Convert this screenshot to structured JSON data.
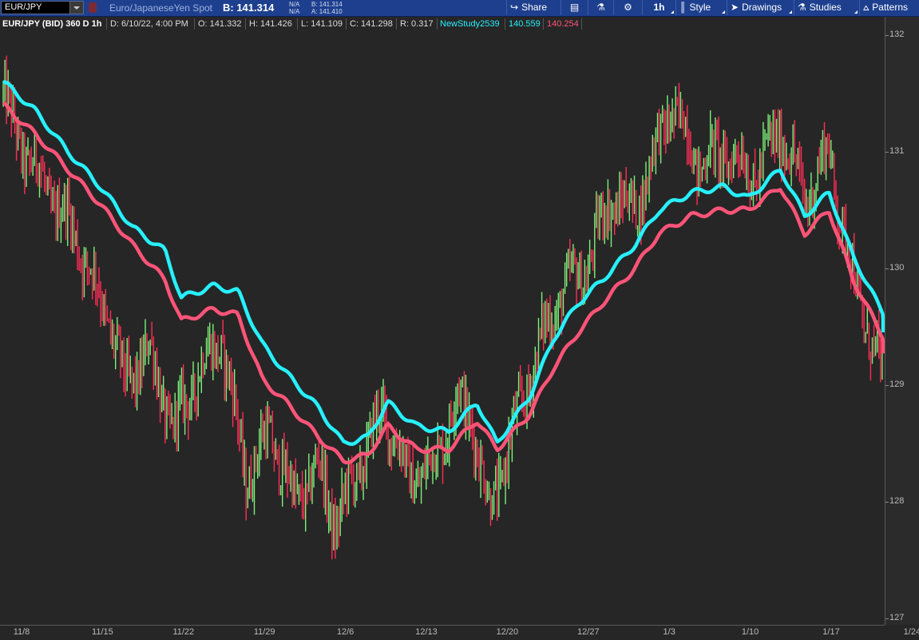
{
  "toolbar": {
    "symbol": "EUR/JPY",
    "description": "Euro/JapaneseYen Spot",
    "bid_price": "B: 141.314",
    "mini_left": [
      "N/A",
      "N/A"
    ],
    "mini_right": [
      "B: 141.314",
      "A: 141.410"
    ],
    "share": "Share",
    "timeframe": "1h",
    "style": "Style",
    "drawings": "Drawings",
    "studies": "Studies",
    "patterns": "Patterns"
  },
  "infobar": {
    "title": "EUR/JPY (BID) 360 D 1h",
    "date": "D: 6/10/22, 4:00 PM",
    "open": "O: 141.332",
    "high": "H: 141.426",
    "low": "L: 141.109",
    "close": "C: 141.298",
    "range": "R: 0.317",
    "study_name": "NewStudy2539",
    "study_value_1": "140.559",
    "study_value_2": "140.254"
  },
  "colors": {
    "up": "#7df07a",
    "down": "#ff2d55",
    "study_1": "#27f0ff",
    "study_2": "#ff5478",
    "study_name": "#27f0ff"
  },
  "chart_data": {
    "type": "line",
    "ylim": [
      127,
      132
    ],
    "y_ticks": [
      "132",
      "131",
      "130",
      "129",
      "128",
      "127"
    ],
    "x_ticks": [
      "11/8",
      "11/15",
      "11/22",
      "11/29",
      "12/6",
      "12/13",
      "12/20",
      "12/27",
      "1/3",
      "1/10",
      "1/17",
      "1/24"
    ],
    "price_path": [
      [
        0,
        131.5
      ],
      [
        0.12,
        131.2
      ],
      [
        0.35,
        130.9
      ],
      [
        0.6,
        130.6
      ],
      [
        0.9,
        130.3
      ],
      [
        1.1,
        129.9
      ],
      [
        1.3,
        129.6
      ],
      [
        1.5,
        129.0
      ],
      [
        1.8,
        129.3
      ],
      [
        2.1,
        128.6
      ],
      [
        2.4,
        129.1
      ],
      [
        2.7,
        129.4
      ],
      [
        3.0,
        128.2
      ],
      [
        3.3,
        128.6
      ],
      [
        3.6,
        128.0
      ],
      [
        3.9,
        128.3
      ],
      [
        4.1,
        127.8
      ],
      [
        4.4,
        128.3
      ],
      [
        4.7,
        128.8
      ],
      [
        5.0,
        128.2
      ],
      [
        5.3,
        128.3
      ],
      [
        5.6,
        128.9
      ],
      [
        5.8,
        128.7
      ],
      [
        6.0,
        127.9
      ],
      [
        6.3,
        128.6
      ],
      [
        6.6,
        129.3
      ],
      [
        6.9,
        129.8
      ],
      [
        7.2,
        130.0
      ],
      [
        7.5,
        130.6
      ],
      [
        7.8,
        130.5
      ],
      [
        8.0,
        130.9
      ],
      [
        8.25,
        131.4
      ],
      [
        8.6,
        130.9
      ],
      [
        8.9,
        131.0
      ],
      [
        9.3,
        130.8
      ],
      [
        9.6,
        131.2
      ],
      [
        9.9,
        130.6
      ],
      [
        10.2,
        131.0
      ],
      [
        10.5,
        129.9
      ],
      [
        10.8,
        129.2
      ],
      [
        11.0,
        128.6
      ]
    ],
    "series": [
      {
        "name": "NewStudy2539",
        "values": [
          [
            0,
            131.6
          ],
          [
            0.4,
            131.35
          ],
          [
            0.8,
            131.0
          ],
          [
            1.2,
            130.7
          ],
          [
            1.6,
            130.35
          ],
          [
            2.0,
            130.15
          ],
          [
            2.2,
            129.75
          ],
          [
            2.6,
            129.85
          ],
          [
            2.9,
            129.8
          ],
          [
            3.2,
            129.35
          ],
          [
            3.5,
            129.1
          ],
          [
            3.9,
            128.8
          ],
          [
            4.2,
            128.5
          ],
          [
            4.5,
            128.55
          ],
          [
            4.75,
            128.85
          ],
          [
            5.1,
            128.65
          ],
          [
            5.5,
            128.6
          ],
          [
            5.85,
            128.85
          ],
          [
            6.1,
            128.5
          ],
          [
            6.5,
            128.9
          ],
          [
            6.8,
            129.4
          ],
          [
            7.1,
            129.7
          ],
          [
            7.4,
            129.9
          ],
          [
            7.8,
            130.2
          ],
          [
            8.1,
            130.5
          ],
          [
            8.5,
            130.65
          ],
          [
            8.9,
            130.7
          ],
          [
            9.2,
            130.6
          ],
          [
            9.6,
            130.85
          ],
          [
            9.9,
            130.45
          ],
          [
            10.2,
            130.65
          ],
          [
            10.5,
            130.1
          ],
          [
            10.8,
            129.7
          ],
          [
            11.0,
            129.45
          ]
        ]
      },
      {
        "name": "",
        "values": [
          [
            0,
            131.4
          ],
          [
            0.4,
            131.15
          ],
          [
            0.8,
            130.85
          ],
          [
            1.2,
            130.55
          ],
          [
            1.6,
            130.2
          ],
          [
            2.0,
            129.9
          ],
          [
            2.2,
            129.55
          ],
          [
            2.6,
            129.65
          ],
          [
            2.9,
            129.6
          ],
          [
            3.2,
            129.05
          ],
          [
            3.5,
            128.85
          ],
          [
            3.9,
            128.55
          ],
          [
            4.2,
            128.35
          ],
          [
            4.5,
            128.4
          ],
          [
            4.75,
            128.65
          ],
          [
            5.1,
            128.45
          ],
          [
            5.5,
            128.45
          ],
          [
            5.85,
            128.7
          ],
          [
            6.1,
            128.45
          ],
          [
            6.5,
            128.75
          ],
          [
            6.8,
            129.15
          ],
          [
            7.1,
            129.45
          ],
          [
            7.4,
            129.7
          ],
          [
            7.8,
            130.0
          ],
          [
            8.1,
            130.3
          ],
          [
            8.5,
            130.45
          ],
          [
            8.9,
            130.5
          ],
          [
            9.2,
            130.5
          ],
          [
            9.6,
            130.7
          ],
          [
            9.9,
            130.3
          ],
          [
            10.2,
            130.5
          ],
          [
            10.5,
            129.9
          ],
          [
            10.8,
            129.5
          ],
          [
            11.0,
            129.25
          ]
        ]
      }
    ]
  }
}
